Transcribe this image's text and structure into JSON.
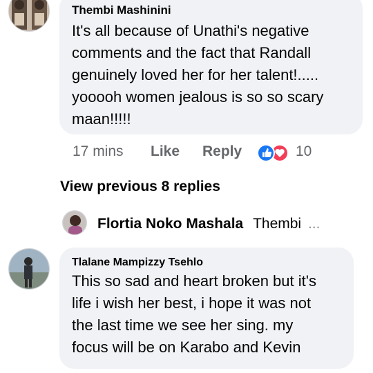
{
  "comments": [
    {
      "author": "Thembi Mashinini",
      "text_lines": [
        "It's all because of Unathi's negative",
        "comments and the fact that Randall",
        "genuinely loved her for her talent!.....",
        "yooooh women jealous is so so scary",
        "maan!!!!!"
      ],
      "time": "17 mins",
      "like_label": "Like",
      "reply_label": "Reply",
      "reaction_count": "10",
      "reaction_icons": [
        "like-icon",
        "love-icon"
      ]
    },
    {
      "author": "Tlalane Mampizzy Tsehlo",
      "text_lines": [
        "This so sad and heart broken but it's",
        "life i wish her best, i hope it was not",
        "the last time we see her sing. my",
        "focus will be on Karabo and Kevin"
      ]
    }
  ],
  "view_previous": "View previous 8 replies",
  "reply_preview": {
    "author": "Flortia Noko Mashala",
    "snippet": "Thembi",
    "ellipsis": "..."
  },
  "colors": {
    "bubble": "#f0f2f5",
    "meta_text": "#65676b",
    "like_blue": "#1877f2",
    "love_red": "#f33e58"
  }
}
